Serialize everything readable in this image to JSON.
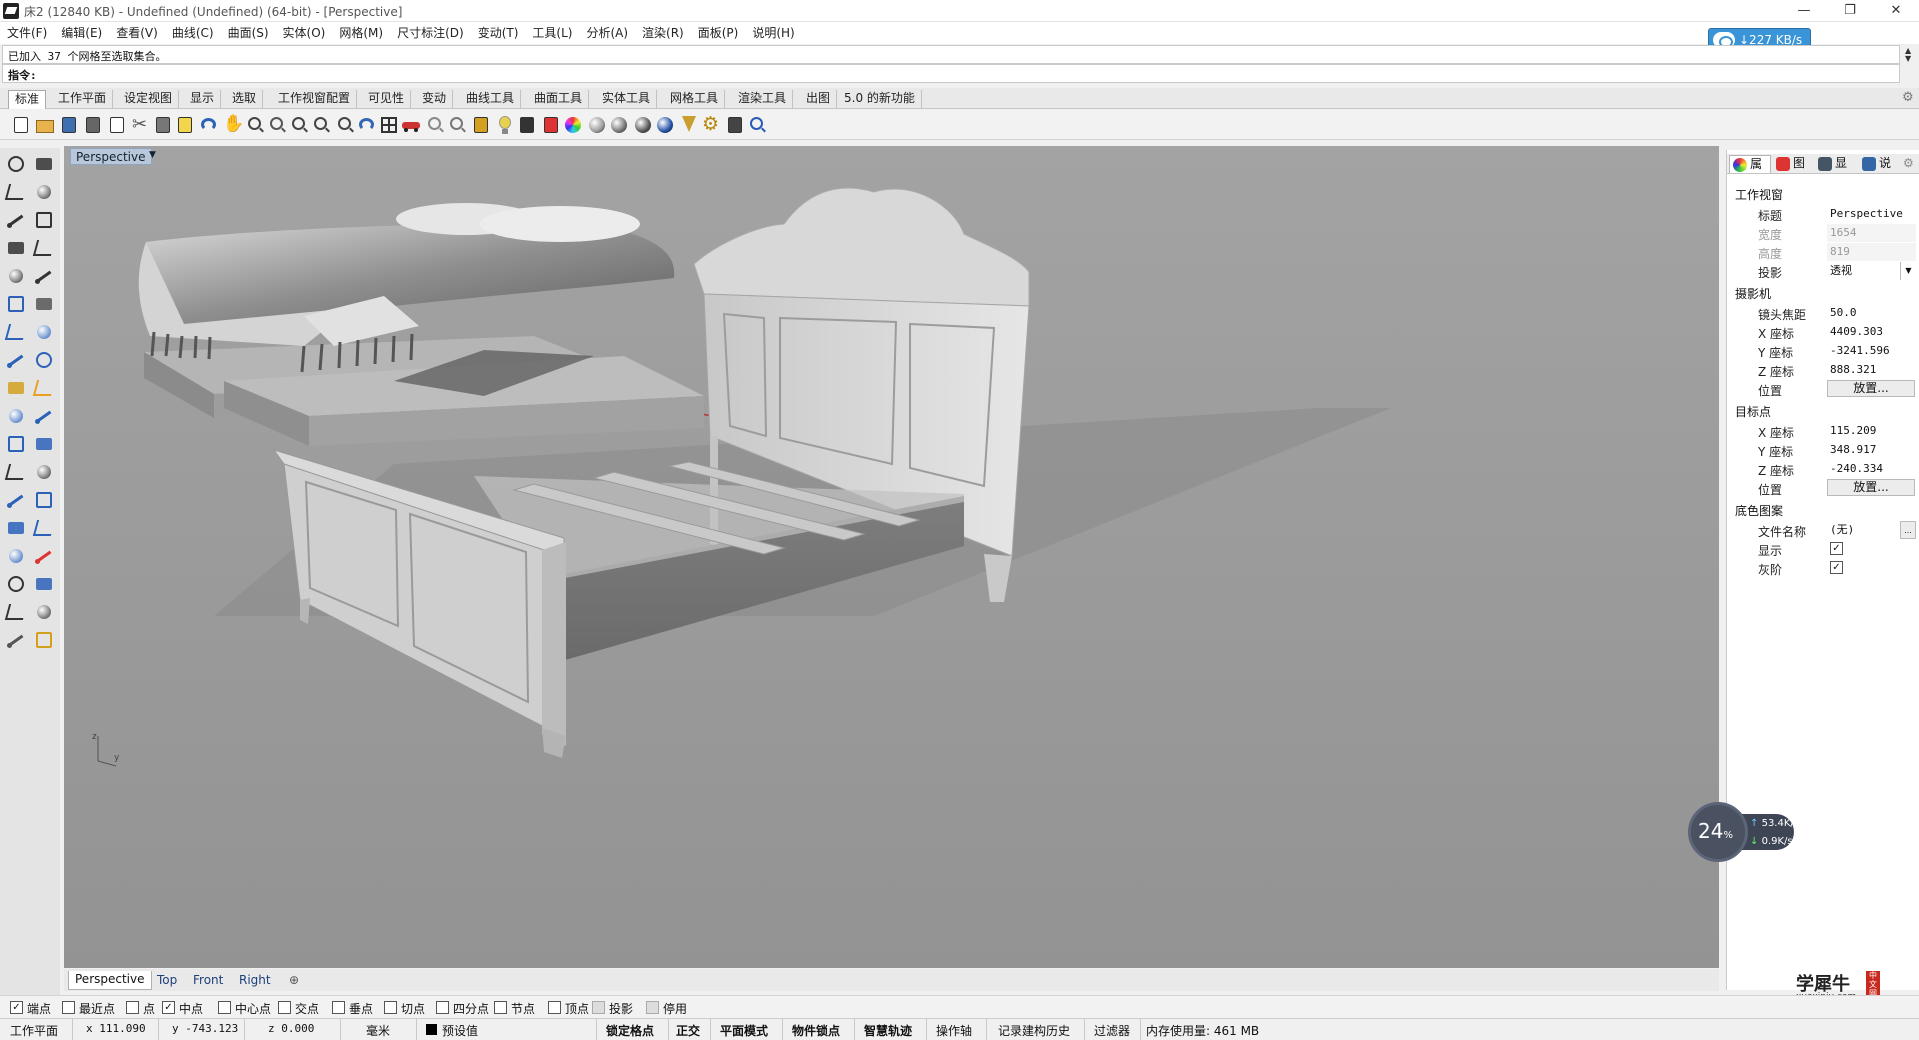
{
  "window": {
    "title": "床2 (12840 KB) - Undefined (Undefined) (64-bit) - [Perspective]",
    "controls": [
      "—",
      "❐",
      "✕"
    ]
  },
  "menu": [
    "文件(F)",
    "编辑(E)",
    "查看(V)",
    "曲线(C)",
    "曲面(S)",
    "实体(O)",
    "网格(M)",
    "尺寸标注(D)",
    "变动(T)",
    "工具(L)",
    "分析(A)",
    "渲染(R)",
    "面板(P)",
    "说明(H)"
  ],
  "command": {
    "history": "已加入 37 个网格至选取集合。",
    "prompt": "指令:"
  },
  "download_badge": "↓227 KB/s",
  "tabs": [
    "标准",
    "工作平面",
    "设定视图",
    "显示",
    "选取",
    "工作视窗配置",
    "可见性",
    "变动",
    "曲线工具",
    "曲面工具",
    "实体工具",
    "网格工具",
    "渲染工具",
    "出图",
    "5.0 的新功能"
  ],
  "toolbar_icons": [
    "new-icon",
    "open-icon",
    "save-icon",
    "print-icon",
    "import-icon",
    "cut-icon",
    "copy-icon",
    "paste-icon",
    "undo-icon",
    "pan-icon",
    "rotate-view-icon",
    "zoom-icon",
    "zoom-window-icon",
    "zoom-extents-icon",
    "zoom-selected-icon",
    "undo-view-icon",
    "four-viewports-icon",
    "car-icon",
    "shaded-icon",
    "object-snap-icon",
    "points-icon",
    "lightbulb-icon",
    "lock-icon",
    "layer-icon",
    "color-wheel-icon",
    "sphere-shaded-icon",
    "sphere-rendered-icon",
    "sphere-material-icon",
    "globe-icon",
    "brush-icon",
    "gear-icon",
    "dimension-icon",
    "help-icon"
  ],
  "left_icons": [
    "select-icon",
    "point-icon",
    "polyline-icon",
    "curve-icon",
    "circle-icon",
    "ellipse-icon",
    "polygon-icon",
    "rectangle-icon",
    "arc-icon",
    "fillet-icon",
    "transform-icon",
    "split-icon",
    "box-icon",
    "boolean-icon",
    "extrude-icon",
    "surface-icon",
    "explode-icon",
    "light-icon",
    "trim-icon",
    "join-icon",
    "group-icon",
    "ungroup-icon",
    "curve-bend-icon",
    "offset-icon",
    "text-icon",
    "scale-icon",
    "array-icon",
    "align-icon",
    "solid-icon",
    "mesh-icon",
    "grid-icon",
    "dimension-icon",
    "gumball-icon",
    "check-icon",
    "analyze-icon",
    "render-icon"
  ],
  "viewport": {
    "title": "Perspective",
    "axis_labels": {
      "z": "z",
      "y": "y"
    },
    "tabs": [
      "Perspective",
      "Top",
      "Front",
      "Right"
    ],
    "add_tab": "⊕"
  },
  "panel": {
    "tabs": [
      "属",
      "图",
      "显",
      "说"
    ],
    "section_viewport": "工作视窗",
    "title_label": "标题",
    "title_value": "Perspective",
    "width_label": "宽度",
    "width_value": "1654",
    "height_label": "高度",
    "height_value": "819",
    "projection_label": "投影",
    "projection_value": "透视",
    "section_camera": "摄影机",
    "focal_label": "镜头焦距",
    "focal_value": "50.0",
    "cam_x_label": "X 座标",
    "cam_x_value": "4409.303",
    "cam_y_label": "Y 座标",
    "cam_y_value": "-3241.596",
    "cam_z_label": "Z 座标",
    "cam_z_value": "888.321",
    "cam_pos_label": "位置",
    "cam_pos_button": "放置...",
    "section_target": "目标点",
    "tgt_x_label": "X 座标",
    "tgt_x_value": "115.209",
    "tgt_y_label": "Y 座标",
    "tgt_y_value": "348.917",
    "tgt_z_label": "Z 座标",
    "tgt_z_value": "-240.334",
    "tgt_pos_label": "位置",
    "tgt_pos_button": "放置...",
    "section_wallpaper": "底色图案",
    "file_label": "文件名称",
    "file_value": "(无)",
    "file_button": "...",
    "show_label": "显示",
    "show_checked": true,
    "gray_label": "灰阶",
    "gray_checked": true
  },
  "osnaps": [
    {
      "label": "端点",
      "checked": true
    },
    {
      "label": "最近点",
      "checked": false
    },
    {
      "label": "点",
      "checked": false
    },
    {
      "label": "中点",
      "checked": true
    },
    {
      "label": "中心点",
      "checked": false
    },
    {
      "label": "交点",
      "checked": false
    },
    {
      "label": "垂点",
      "checked": false
    },
    {
      "label": "切点",
      "checked": false
    },
    {
      "label": "四分点",
      "checked": false
    },
    {
      "label": "节点",
      "checked": false
    },
    {
      "label": "顶点",
      "checked": false
    },
    {
      "label": "投影",
      "checked": false,
      "disabled": true
    },
    {
      "label": "停用",
      "checked": false,
      "disabled": true
    }
  ],
  "status": {
    "cplane": "工作平面",
    "x": "x 111.090",
    "y": "y -743.123",
    "z": "z 0.000",
    "unit": "毫米",
    "layer": "预设值",
    "grid_snap": "锁定格点",
    "ortho": "正交",
    "planar": "平面模式",
    "osnap": "物件锁点",
    "smarttrack": "智慧轨迹",
    "gumball": "操作轴",
    "history": "记录建构历史",
    "filter": "过滤器",
    "memory": "内存使用量: 461 MB"
  },
  "perf": {
    "percent": "24",
    "percent_sign": "%",
    "up": "53.4K/s",
    "down": "0.9K/s"
  },
  "watermark": {
    "name": "学犀牛",
    "site": "xuexiniu.com",
    "seal": "中文网"
  },
  "colors": {
    "viewport_bg": "#9b9b9b",
    "accent": "#3a94d8"
  }
}
